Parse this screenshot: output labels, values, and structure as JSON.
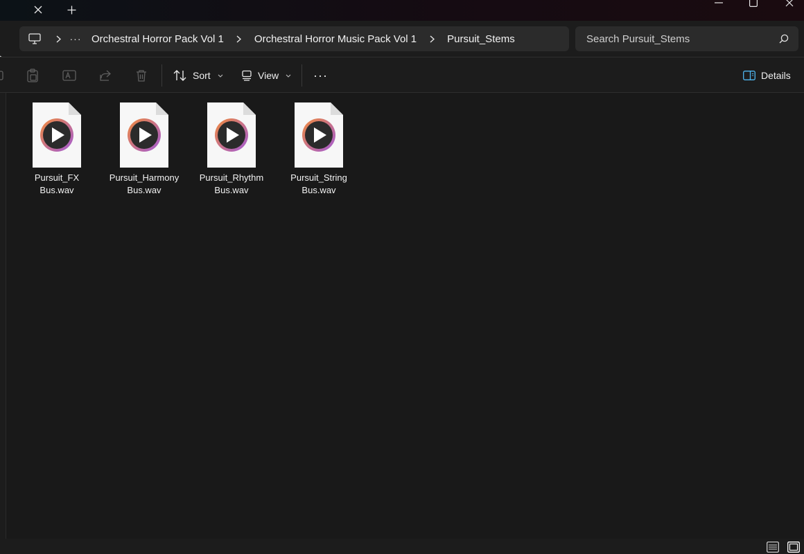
{
  "window": {
    "tab_close_icon": "close-icon",
    "new_tab_icon": "plus-icon"
  },
  "address": {
    "breadcrumb": [
      "Orchestral Horror Pack Vol 1",
      "Orchestral Horror Music Pack Vol 1",
      "Pursuit_Stems"
    ],
    "more": "···",
    "search_placeholder": "Search Pursuit_Stems"
  },
  "toolbar": {
    "sort_label": "Sort",
    "view_label": "View",
    "more": "···",
    "details_label": "Details"
  },
  "files": [
    {
      "line1": "Pursuit_FX",
      "line2": "Bus.wav"
    },
    {
      "line1": "Pursuit_Harmony",
      "line2": "Bus.wav"
    },
    {
      "line1": "Pursuit_Rhythm",
      "line2": "Bus.wav"
    },
    {
      "line1": "Pursuit_String",
      "line2": "Bus.wav"
    }
  ],
  "colors": {
    "background": "#191919",
    "bar": "#2b2b2b",
    "icon_ring_start": "#f08a3c",
    "icon_ring_end": "#a25ad6"
  }
}
